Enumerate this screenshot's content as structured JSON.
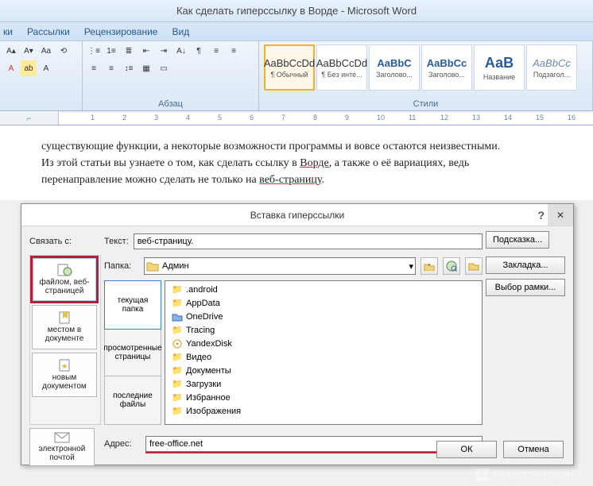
{
  "title": "Как сделать гиперссылку в Ворде - Microsoft Word",
  "tabs": {
    "t0": "ки",
    "t1": "Рассылки",
    "t2": "Рецензирование",
    "t3": "Вид"
  },
  "ribbon": {
    "group_paragraph": "Абзац",
    "group_styles": "Стили",
    "styles": {
      "s0": {
        "prev": "AaBbCcDd",
        "name": "¶ Обычный"
      },
      "s1": {
        "prev": "AaBbCcDd",
        "name": "¶ Без инте..."
      },
      "s2": {
        "prev": "AaBbC",
        "name": "Заголово..."
      },
      "s3": {
        "prev": "AaBbCc",
        "name": "Заголово..."
      },
      "s4": {
        "prev": "АаВ",
        "name": "Название"
      },
      "s5": {
        "prev": "AaBbCc",
        "name": "Подзагол..."
      }
    }
  },
  "ruler": {
    "n1": "1",
    "n2": "2",
    "n3": "3",
    "n4": "4",
    "n5": "5",
    "n6": "6",
    "n7": "7",
    "n8": "8",
    "n9": "9",
    "n10": "10",
    "n11": "11",
    "n12": "12",
    "n13": "13",
    "n14": "14",
    "n15": "15",
    "n16": "16"
  },
  "doc": {
    "l1a": "существующие функции, а некоторые возможности программы и вовсе остаются неизвестными.",
    "l2a": "Из этой статьи вы узнаете о том, как сделать ссылку в ",
    "l2link": "Ворде",
    "l2b": ", а также о её вариациях, ведь",
    "l3a": "перенаправление можно сделать не только на ",
    "l3link": "веб-страницу",
    "l3b": "."
  },
  "dialog": {
    "title": "Вставка гиперссылки",
    "linkto_label": "Связать с:",
    "text_label": "Текст:",
    "text_value": "веб-страницу.",
    "hint_btn": "Подсказка...",
    "folder_label": "Папка:",
    "folder_value": "Админ",
    "bookmark_btn": "Закладка...",
    "frame_btn": "Выбор рамки...",
    "addr_label": "Адрес:",
    "addr_value": "free-office.net",
    "ok": "ОК",
    "cancel": "Отмена",
    "ltabs": {
      "t0": "файлом, веб-страницей",
      "t1": "местом в документе",
      "t2": "новым документом",
      "t3": "электронной почтой"
    },
    "subtabs": {
      "s0": "текущая папка",
      "s1": "просмотренные страницы",
      "s2": "последние файлы"
    },
    "files": {
      "f0": ".android",
      "f1": "AppData",
      "f2": "OneDrive",
      "f3": "Tracing",
      "f4": "YandexDisk",
      "f5": "Видео",
      "f6": "Документы",
      "f7": "Загрузки",
      "f8": "Избранное",
      "f9": "Изображения"
    }
  },
  "watermark": "FREE-OFFICE.NET"
}
